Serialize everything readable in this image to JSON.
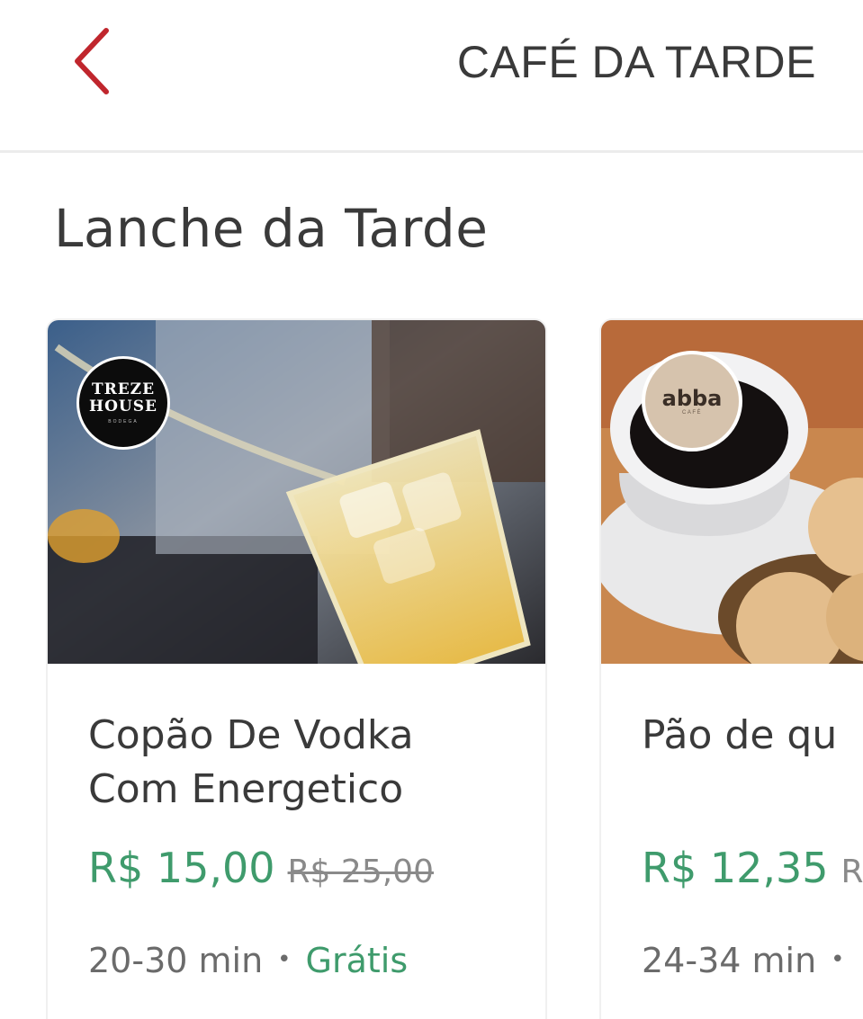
{
  "header": {
    "back_icon": "chevron-left-icon",
    "title": "CAFÉ DA TARDE",
    "accent_color": "#c0262d"
  },
  "section": {
    "title": "Lanche da Tarde"
  },
  "cards": [
    {
      "store_logo": {
        "line1": "TREZE",
        "line2": "HOUSE",
        "line3": "BODEGA"
      },
      "name": "Copão De Vodka\nCom Energetico",
      "price_now": "R$ 15,00",
      "price_old": "R$ 25,00",
      "delivery_time": "20-30 min",
      "separator": "•",
      "delivery_fee": "Grátis"
    },
    {
      "store_logo": {
        "line1": "abba",
        "line2": "CAFÉ"
      },
      "name": "Pão de qu",
      "price_now": "R$ 12,35",
      "price_old": "R",
      "delivery_time": "24-34 min",
      "separator": "•"
    }
  ],
  "colors": {
    "price_green": "#3f9b6c",
    "text_dark": "#3a3a3a",
    "text_muted": "#8a8a8a"
  }
}
